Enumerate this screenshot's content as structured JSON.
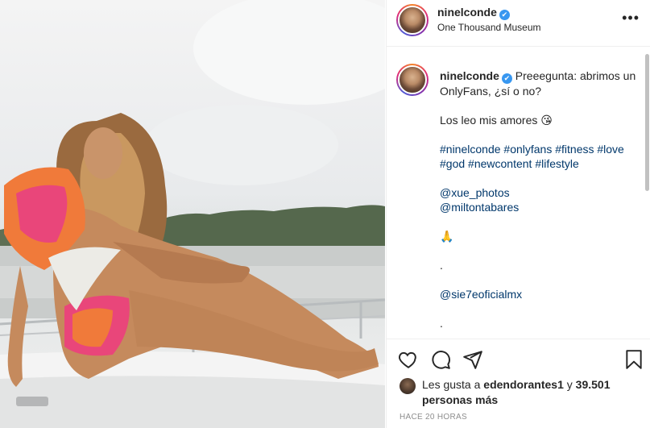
{
  "post": {
    "username": "ninelconde",
    "verified_mark": "✔",
    "location": "One Thousand Museum",
    "more_icon": "more-options-icon",
    "more_label": "•••"
  },
  "caption": {
    "username": "ninelconde",
    "text": "Preeegunta: abrimos un OnlyFans, ¿sí o no?",
    "line2": "Los leo mis amores 😘",
    "hashtags": [
      "#ninelconde",
      "#onlyfans",
      "#fitness",
      "#love",
      "#god",
      "#newcontent",
      "#lifestyle"
    ],
    "mentions": [
      "@xue_photos",
      "@miltontabares"
    ],
    "emoji": "🙏",
    "dot1": ".",
    "mention3": "@sie7eoficialmx",
    "dot2": "."
  },
  "actions": {
    "like_icon": "heart-icon",
    "comment_icon": "comment-icon",
    "share_icon": "share-icon",
    "save_icon": "bookmark-icon"
  },
  "likes": {
    "prefix": "Les gusta a",
    "user": "edendorantes1",
    "conj": "y",
    "count": "39.501 personas más"
  },
  "timestamp": "HACE 20 HORAS",
  "colors": {
    "link": "#00376b",
    "verified": "#3897f0",
    "muted": "#8e8e8e"
  }
}
